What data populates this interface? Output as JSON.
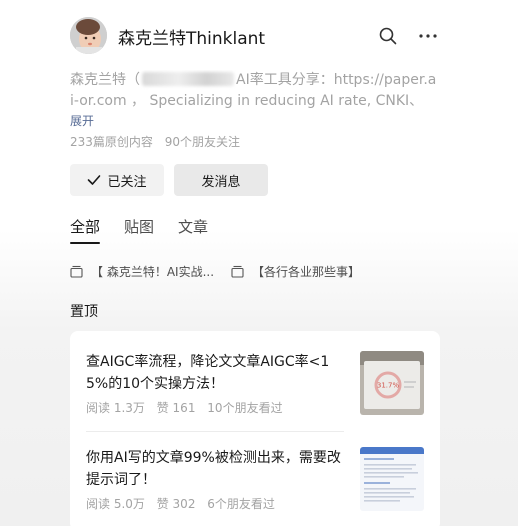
{
  "header": {
    "name": "森克兰特Thinklant"
  },
  "profile": {
    "desc_prefix": "森克兰特（",
    "desc_suffix": "AI率工具分享：https://paper.ai-or.com ， Specializing in reducing AI rate, CNKI、T...",
    "expand_label": "展开",
    "articles_count": "233篇原创内容",
    "friends_follow": "90个朋友关注"
  },
  "actions": {
    "follow_label": "已关注",
    "message_label": "发消息"
  },
  "tabs": [
    {
      "label": "全部",
      "active": true
    },
    {
      "label": "贴图",
      "active": false
    },
    {
      "label": "文章",
      "active": false
    }
  ],
  "collections": [
    {
      "label": "【 森克兰特！AI实战..."
    },
    {
      "label": "【各行各业那些事】"
    }
  ],
  "pinned": {
    "section_title": "置顶",
    "articles": [
      {
        "title": "查AIGC率流程，降论文文章AIGC率<15%的10个实操方法！",
        "reads": "阅读 1.3万",
        "likes": "赞 161",
        "friends": "10个朋友看过",
        "thumb_text": "31.7%"
      },
      {
        "title": "你用AI写的文章99%被检测出来，需要改提示词了！",
        "reads": "阅读 5.0万",
        "likes": "赞 302",
        "friends": "6个朋友看过"
      }
    ]
  },
  "colors": {
    "link": "#576b95",
    "muted": "#a3a3a3",
    "text": "#191919"
  }
}
